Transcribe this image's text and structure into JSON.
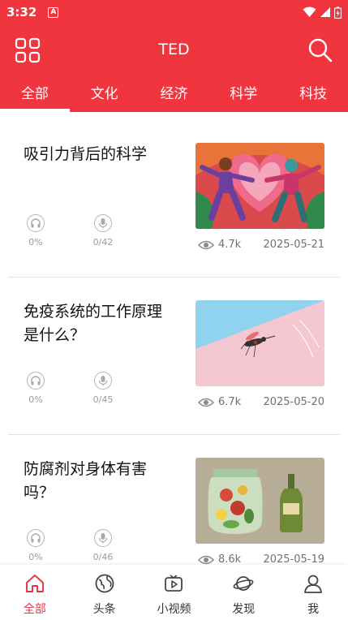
{
  "status": {
    "time": "3:32",
    "a_icon": "A"
  },
  "appbar": {
    "title": "TED"
  },
  "tabs": [
    {
      "label": "全部"
    },
    {
      "label": "文化"
    },
    {
      "label": "经济"
    },
    {
      "label": "科学"
    },
    {
      "label": "科技"
    }
  ],
  "articles": [
    {
      "title": "吸引力背后的科学",
      "listen_pct": "0%",
      "record_count": "0/42",
      "views": "4.7k",
      "date": "2025-05-21",
      "thumb_icon": "dancing-couple-illustration"
    },
    {
      "title": "免疫系统的工作原理是什么？",
      "listen_pct": "0%",
      "record_count": "0/45",
      "views": "6.7k",
      "date": "2025-05-20",
      "thumb_icon": "mosquito-illustration"
    },
    {
      "title": "防腐剂对身体有害吗？",
      "listen_pct": "0%",
      "record_count": "0/46",
      "views": "8.6k",
      "date": "2025-05-19",
      "thumb_icon": "pickle-jar-illustration"
    }
  ],
  "bottom_nav": [
    {
      "label": "全部",
      "icon": "home-icon"
    },
    {
      "label": "头条",
      "icon": "globe-icon"
    },
    {
      "label": "小视频",
      "icon": "video-play-icon"
    },
    {
      "label": "发现",
      "icon": "planet-icon"
    },
    {
      "label": "我",
      "icon": "user-icon"
    }
  ],
  "colors": {
    "brand": "#f0353f",
    "nav_active": "#e83442"
  }
}
